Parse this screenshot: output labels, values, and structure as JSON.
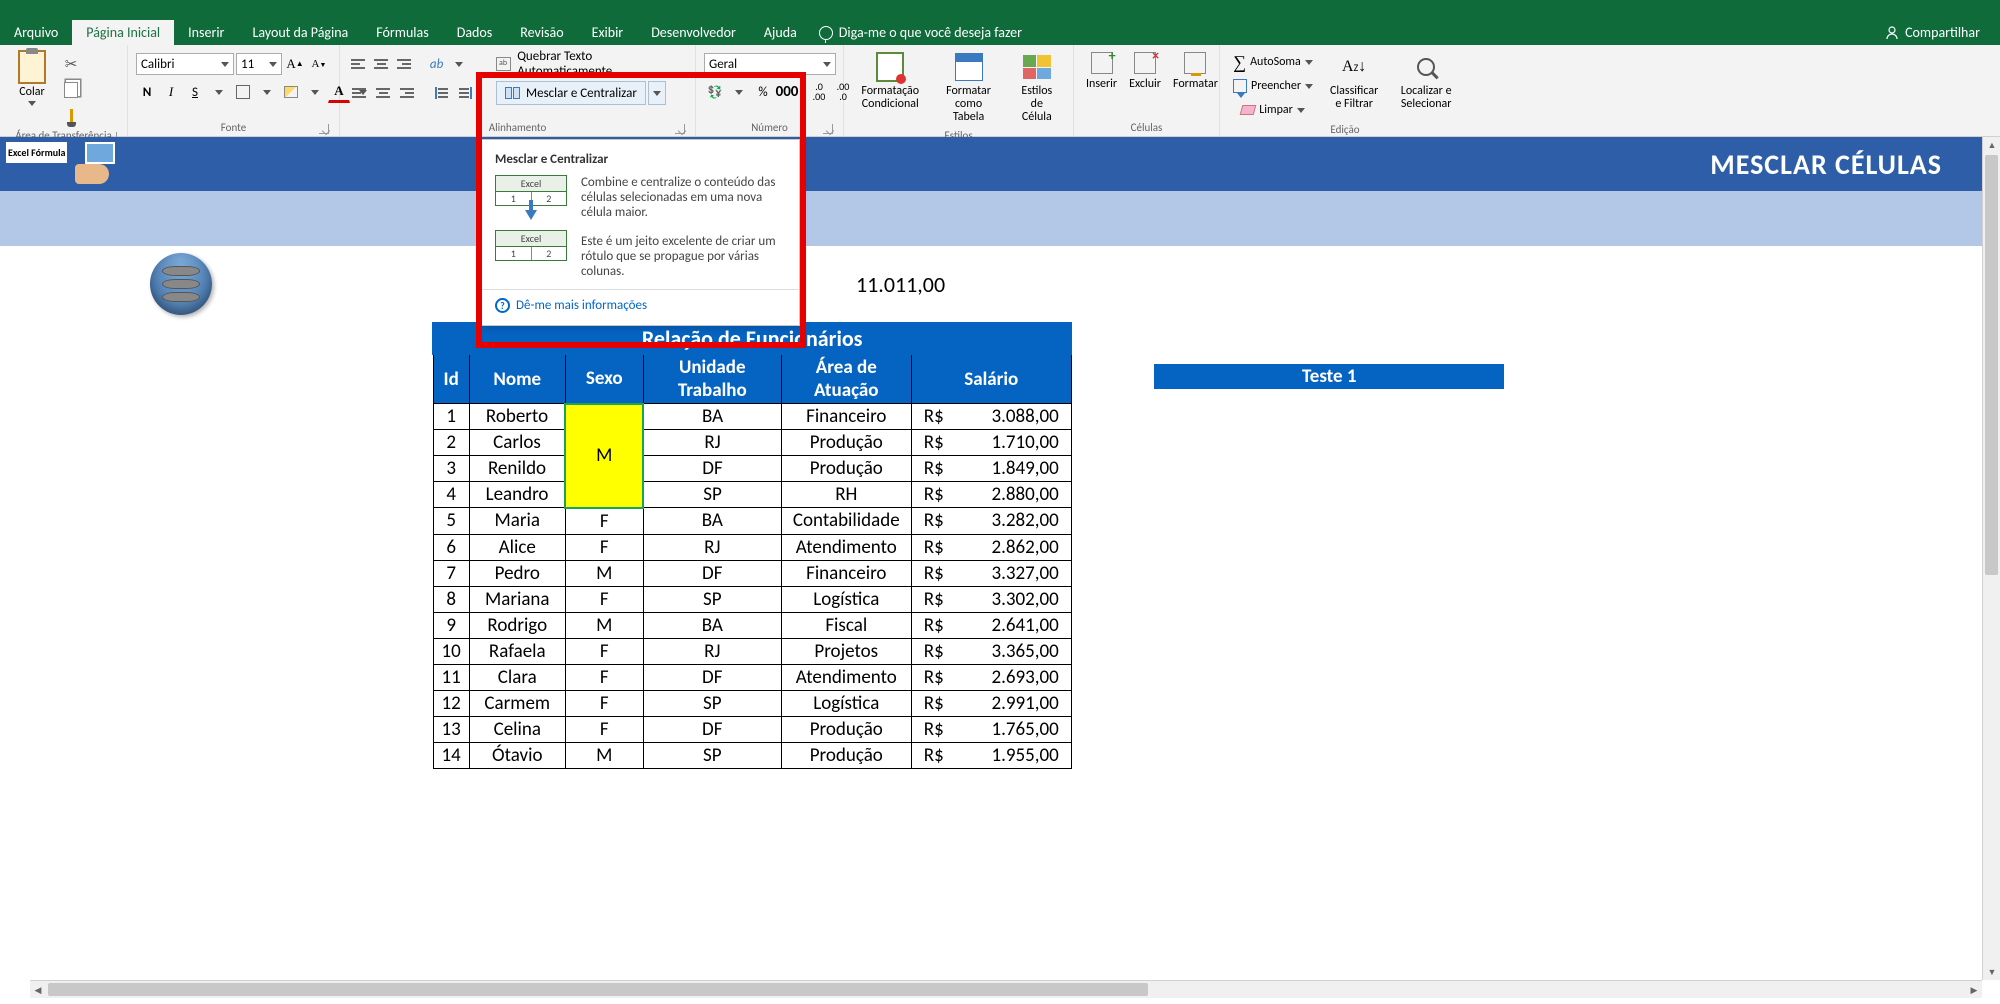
{
  "menu": {
    "tabs": [
      "Arquivo",
      "Página Inicial",
      "Inserir",
      "Layout da Página",
      "Fórmulas",
      "Dados",
      "Revisão",
      "Exibir",
      "Desenvolvedor",
      "Ajuda"
    ],
    "active_index": 1,
    "tell_me": "Diga-me o que você deseja fazer",
    "share": "Compartilhar"
  },
  "ribbon": {
    "clipboard": {
      "label": "Área de Transferência",
      "paste": "Colar"
    },
    "font": {
      "label": "Fonte",
      "name": "Calibri",
      "size": "11",
      "bold": "N",
      "italic": "I",
      "underline": "S"
    },
    "alignment": {
      "label": "Alinhamento",
      "wrap": "Quebrar Texto Automaticamente",
      "merge": "Mesclar e Centralizar"
    },
    "number": {
      "label": "Número",
      "format": "Geral"
    },
    "styles": {
      "label": "Estilos",
      "cf": "Formatação Condicional",
      "tbl": "Formatar como Tabela",
      "cell": "Estilos de Célula"
    },
    "cells": {
      "label": "Células",
      "ins": "Inserir",
      "del": "Excluir",
      "fmt": "Formatar"
    },
    "editing": {
      "label": "Edição",
      "sum": "AutoSoma",
      "fill": "Preencher",
      "clear": "Limpar",
      "sort": "Classificar e Filtrar",
      "find": "Localizar e Selecionar"
    }
  },
  "tooltip": {
    "title": "Mesclar e Centralizar",
    "p1": "Combine e centralize o conteúdo das células selecionadas em uma nova célula maior.",
    "p2": "Este é um jeito excelente de criar um rótulo que se propague por várias colunas.",
    "more": "Dê-me mais informações",
    "demo_label": "Excel"
  },
  "sheet": {
    "banner_logo": "Excel Fórmula",
    "banner_title": "MESCLAR CÉLULAS",
    "soma": "11.011,00",
    "table_title": "Relação de Funcionários",
    "headers": [
      "Id",
      "Nome",
      "Sexo",
      "Unidade Trabalho",
      "Área de Atuação",
      "Salário"
    ],
    "merged_value": "M",
    "rows": [
      {
        "id": "1",
        "nome": "Roberto",
        "sexo": "",
        "ut": "BA",
        "area": "Financeiro",
        "cur": "R$",
        "sal": "3.088,00"
      },
      {
        "id": "2",
        "nome": "Carlos",
        "sexo": "",
        "ut": "RJ",
        "area": "Produção",
        "cur": "R$",
        "sal": "1.710,00"
      },
      {
        "id": "3",
        "nome": "Renildo",
        "sexo": "",
        "ut": "DF",
        "area": "Produção",
        "cur": "R$",
        "sal": "1.849,00"
      },
      {
        "id": "4",
        "nome": "Leandro",
        "sexo": "",
        "ut": "SP",
        "area": "RH",
        "cur": "R$",
        "sal": "2.880,00"
      },
      {
        "id": "5",
        "nome": "Maria",
        "sexo": "F",
        "ut": "BA",
        "area": "Contabilidade",
        "cur": "R$",
        "sal": "3.282,00"
      },
      {
        "id": "6",
        "nome": "Alice",
        "sexo": "F",
        "ut": "RJ",
        "area": "Atendimento",
        "cur": "R$",
        "sal": "2.862,00"
      },
      {
        "id": "7",
        "nome": "Pedro",
        "sexo": "M",
        "ut": "DF",
        "area": "Financeiro",
        "cur": "R$",
        "sal": "3.327,00"
      },
      {
        "id": "8",
        "nome": "Mariana",
        "sexo": "F",
        "ut": "SP",
        "area": "Logística",
        "cur": "R$",
        "sal": "3.302,00"
      },
      {
        "id": "9",
        "nome": "Rodrigo",
        "sexo": "M",
        "ut": "BA",
        "area": "Fiscal",
        "cur": "R$",
        "sal": "2.641,00"
      },
      {
        "id": "10",
        "nome": "Rafaela",
        "sexo": "F",
        "ut": "RJ",
        "area": "Projetos",
        "cur": "R$",
        "sal": "3.365,00"
      },
      {
        "id": "11",
        "nome": "Clara",
        "sexo": "F",
        "ut": "DF",
        "area": "Atendimento",
        "cur": "R$",
        "sal": "2.693,00"
      },
      {
        "id": "12",
        "nome": "Carmem",
        "sexo": "F",
        "ut": "SP",
        "area": "Logística",
        "cur": "R$",
        "sal": "2.991,00"
      },
      {
        "id": "13",
        "nome": "Celina",
        "sexo": "F",
        "ut": "DF",
        "area": "Produção",
        "cur": "R$",
        "sal": "1.765,00"
      },
      {
        "id": "14",
        "nome": "Ótavio",
        "sexo": "M",
        "ut": "SP",
        "area": "Produção",
        "cur": "R$",
        "sal": "1.955,00"
      }
    ],
    "teste": "Teste 1"
  }
}
